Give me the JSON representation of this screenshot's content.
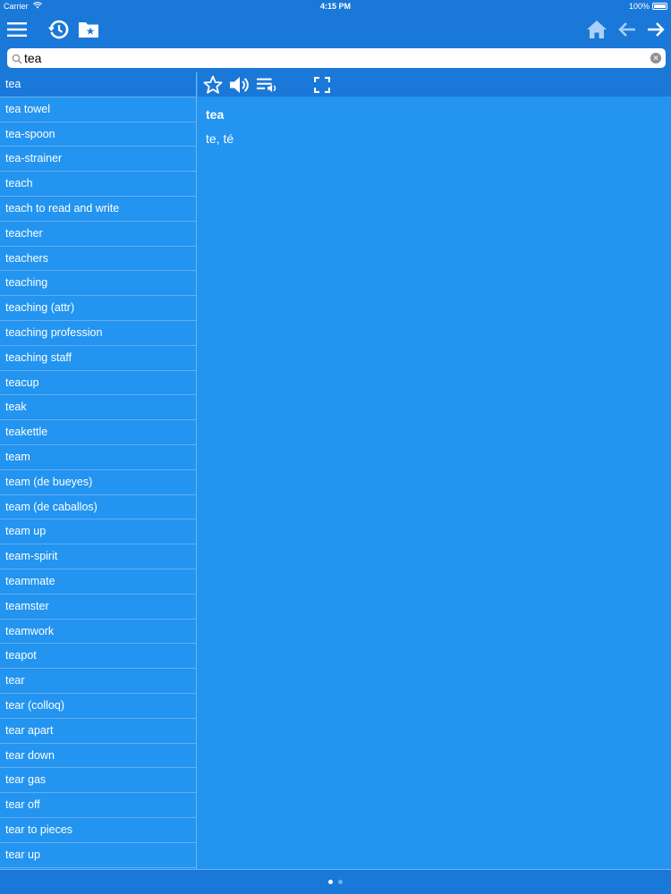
{
  "status_bar": {
    "carrier": "Carrier",
    "time": "4:15 PM",
    "battery": "100%"
  },
  "toolbar": {
    "icons": [
      "menu-icon",
      "history-icon",
      "favorites-folder-icon",
      "home-icon",
      "back-arrow-icon",
      "forward-arrow-icon"
    ]
  },
  "search": {
    "value": "tea",
    "placeholder": ""
  },
  "word_list": {
    "items": [
      "tea",
      "tea towel",
      "tea-spoon",
      "tea-strainer",
      "teach",
      "teach to read and write",
      "teacher",
      "teachers",
      "teaching",
      "teaching (attr)",
      "teaching profession",
      "teaching staff",
      "teacup",
      "teak",
      "teakettle",
      "team",
      "team (de bueyes)",
      "team (de caballos)",
      "team up",
      "team-spirit",
      "teammate",
      "teamster",
      "teamwork",
      "teapot",
      "tear",
      "tear (colloq)",
      "tear apart",
      "tear down",
      "tear gas",
      "tear off",
      "tear to pieces",
      "tear up"
    ],
    "selected_index": 0
  },
  "detail": {
    "headword": "tea",
    "translation": "te, té",
    "icons": [
      "star-icon",
      "speaker-icon",
      "list-audio-icon",
      "fullscreen-icon"
    ]
  },
  "pager": {
    "count": 2,
    "current": 1
  },
  "colors": {
    "accent_dark": "#1a78d8",
    "background": "#2394f0",
    "text": "#ffffff"
  }
}
